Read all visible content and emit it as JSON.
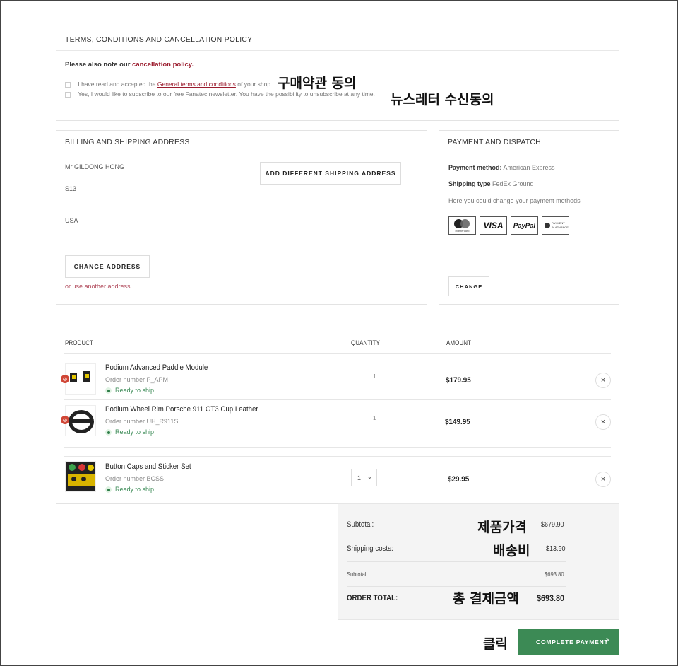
{
  "terms": {
    "heading": "TERMS, CONDITIONS AND CANCELLATION POLICY",
    "note_prefix": "Please also note our",
    "note_link": "cancellation policy.",
    "check1_pre": "I have read and accepted the",
    "check1_link": "General terms and conditions",
    "check1_post": "of your shop.",
    "check2": "Yes, I would like to subscribe to our free Fanatec newsletter. You have the possibility to unsubscribe at any time."
  },
  "billing": {
    "heading": "BILLING AND SHIPPING ADDRESS",
    "name": "Mr GILDONG HONG",
    "line2": "S13",
    "country": "USA",
    "add_shipping_label": "ADD DIFFERENT SHIPPING ADDRESS",
    "change_address_label": "CHANGE ADDRESS",
    "other_address_link": "or use another address"
  },
  "payment": {
    "heading": "PAYMENT AND DISPATCH",
    "method_label": "Payment method:",
    "method_value": "American Express",
    "shipping_label": "Shipping type",
    "shipping_value": "FedEx Ground",
    "hint": "Here you could change your payment methods",
    "change_label": "CHANGE",
    "logos": {
      "mastercard_caption": "mastercard",
      "visa": "VISA",
      "paypal": "PayPal",
      "advance_line1": "PAYMENT",
      "advance_line2": "IN ADVANCE"
    }
  },
  "products": {
    "col_product": "PRODUCT",
    "col_quantity": "QUANTITY",
    "col_amount": "AMOUNT",
    "items": [
      {
        "name": "Podium Advanced Paddle Module",
        "order": "Order number P_APM",
        "status": "Ready to ship",
        "qty": "1",
        "amount": "$179.95"
      },
      {
        "name": "Podium Wheel Rim Porsche 911 GT3 Cup Leather",
        "order": "Order number UH_R911S",
        "status": "Ready to ship",
        "qty": "1",
        "amount": "$149.95"
      },
      {
        "name": "Button Caps and Sticker Set",
        "order": "Order number BCSS",
        "status": "Ready to ship",
        "qty": "1",
        "amount": "$29.95"
      }
    ],
    "remove_glyph": "×",
    "dropdown_glyph": "⌄"
  },
  "summary": {
    "subtotal_label": "Subtotal:",
    "subtotal_value": "$679.90",
    "shipping_label": "Shipping costs:",
    "shipping_value": "$13.90",
    "subtotal2_label": "Subtotal:",
    "subtotal2_value": "$693.80",
    "total_label": "ORDER TOTAL:",
    "total_value": "$693.80"
  },
  "complete_payment_label": "COMPLETE PAYMENT",
  "complete_payment_arrow": ">",
  "annotations": {
    "terms_agree": "구매약관 동의",
    "newsletter": "뉴스레터 수신동의",
    "product_price": "제품가격",
    "shipping_fee": "배송비",
    "total_payment": "총 결제금액",
    "click": "클릭"
  },
  "colors": {
    "accent_red": "#9b1c2e",
    "green": "#2e7d48",
    "complete_button": "#3c8a55",
    "summary_bg": "#f4f4f4"
  }
}
